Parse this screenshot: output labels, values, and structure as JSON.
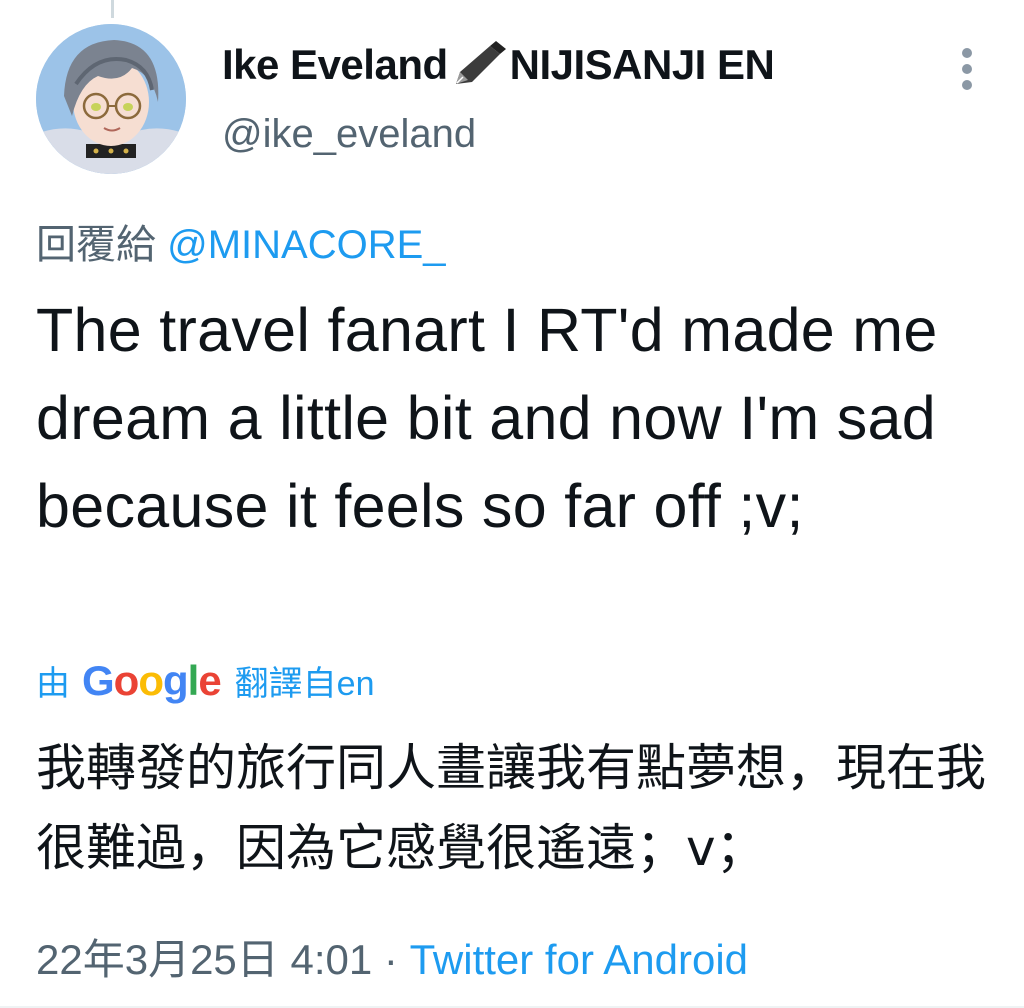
{
  "tweet": {
    "author": {
      "display_name_part1": "Ike Eveland",
      "display_name_icon": "fountain-pen-icon",
      "display_name_part2": "NIJISANJI EN",
      "handle": "@ike_eveland"
    },
    "reply_prefix": "回覆給",
    "reply_to": "@MINACORE_",
    "text": "The travel fanart I RT'd made me dream a little bit and now I'm sad because it feels so far off ;v;",
    "translation": {
      "prefix": "由",
      "provider": "Google",
      "suffix": "翻譯自en",
      "text": "我轉發的旅行同人畫讓我有點夢想，現在我很難過，因為它感覺很遙遠；v；"
    },
    "date": "22年3月25日 4:01",
    "separator": "·",
    "source": "Twitter for Android"
  },
  "colors": {
    "accent": "#1d9bf0",
    "secondary_text": "#536471",
    "primary_text": "#0f1419"
  }
}
